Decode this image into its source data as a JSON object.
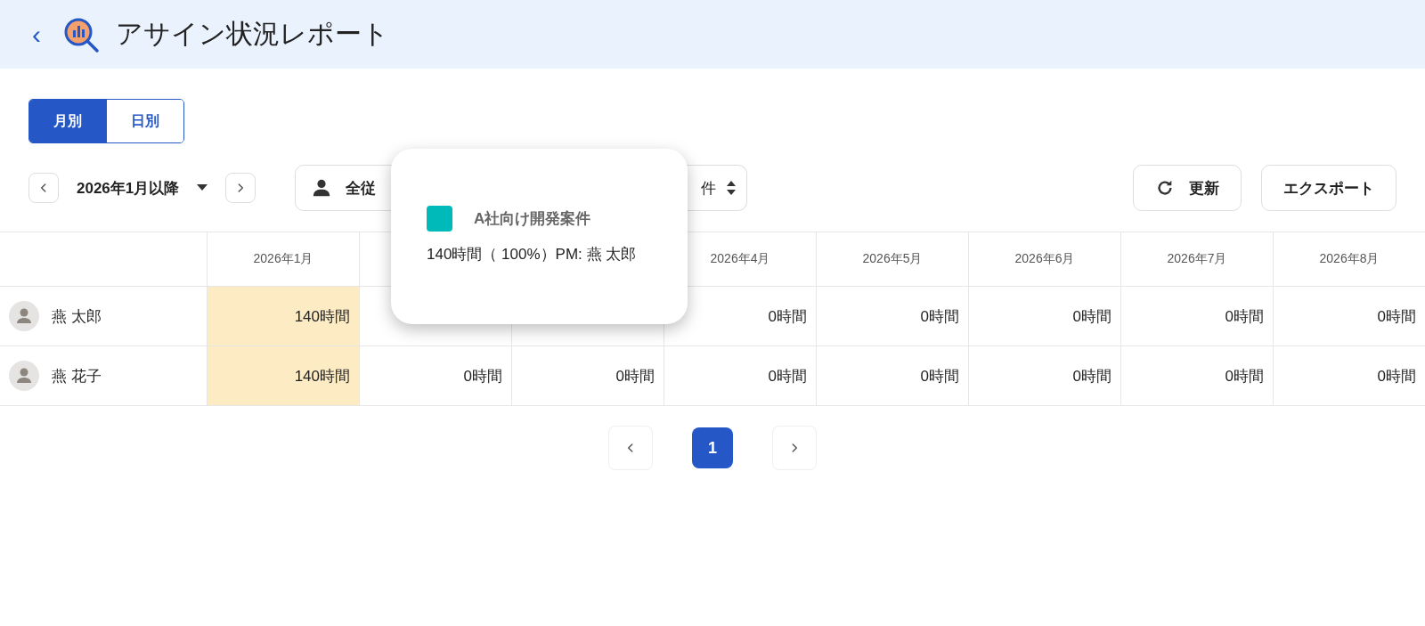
{
  "header": {
    "back": "‹",
    "title": "アサイン状況レポート"
  },
  "view_tabs": [
    {
      "label": "月別",
      "selected": true
    },
    {
      "label": "日別",
      "selected": false
    }
  ],
  "toolbar": {
    "period": "2026年1月以降",
    "employee_filter": "全従",
    "count_select": "件",
    "refresh": "更新",
    "export": "エクスポート"
  },
  "table": {
    "columns": [
      {
        "label": "2026年1月"
      },
      {},
      {},
      {
        "label": "2026年4月"
      },
      {
        "label": "2026年5月"
      },
      {
        "label": "2026年6月"
      },
      {
        "label": "2026年7月"
      },
      {
        "label": "2026年8月"
      }
    ],
    "rows": [
      {
        "name": "燕 太郎",
        "cells": [
          {
            "value": "140時間",
            "highlighted": true
          },
          {},
          {},
          {
            "value": "0時間",
            "highlighted": false
          },
          {
            "value": "0時間",
            "highlighted": false
          },
          {
            "value": "0時間",
            "highlighted": false
          },
          {
            "value": "0時間",
            "highlighted": false
          },
          {
            "value": "0時間",
            "highlighted": false
          }
        ]
      },
      {
        "name": "燕 花子",
        "cells": [
          {
            "value": "140時間",
            "highlighted": true
          },
          {
            "value": "0時間",
            "highlighted": false
          },
          {
            "value": "0時間",
            "highlighted": false
          },
          {
            "value": "0時間",
            "highlighted": false
          },
          {
            "value": "0時間",
            "highlighted": false
          },
          {
            "value": "0時間",
            "highlighted": false
          },
          {
            "value": "0時間",
            "highlighted": false
          },
          {
            "value": "0時間",
            "highlighted": false
          }
        ]
      }
    ]
  },
  "pagination": {
    "pages": [
      {
        "label": "1",
        "selected": true
      }
    ]
  },
  "tooltip": {
    "project": "A社向け開発案件",
    "color": "#00b9b9",
    "detail": "140時間（ 100%）PM: 燕 太郎"
  }
}
